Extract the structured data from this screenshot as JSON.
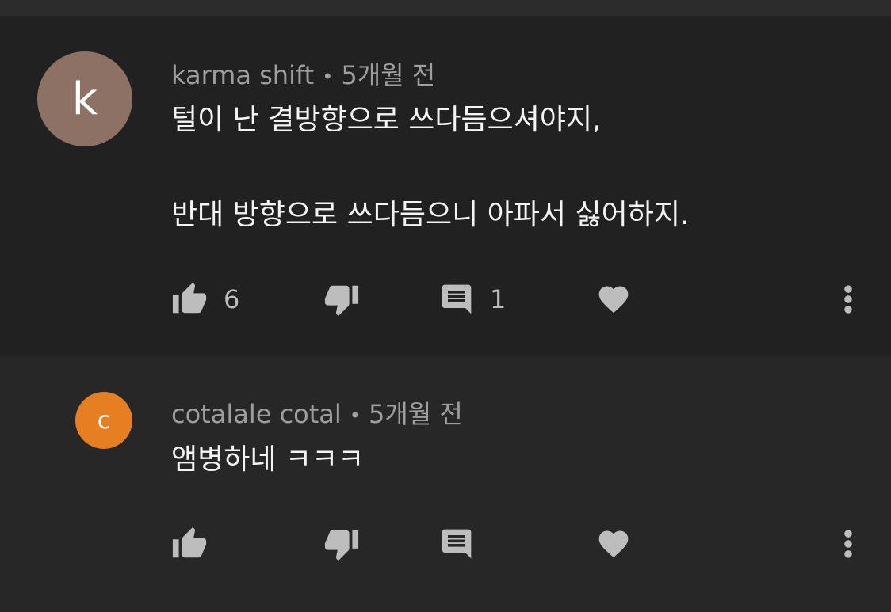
{
  "comments": [
    {
      "avatar_letter": "k",
      "avatar_color": "#8d7164",
      "author": "karma shift",
      "separator": "•",
      "time": "5개월 전",
      "text_lines": [
        "털이 난 결방향으로 쓰다듬으셔야지,",
        "",
        "반대 방향으로 쓰다듬으니 아파서 싫어하지."
      ],
      "like_count": "6",
      "reply_count": "1",
      "icons": [
        "thumbs-up-icon",
        "thumbs-down-icon",
        "comment-icon",
        "heart-icon",
        "more-vert-icon"
      ]
    },
    {
      "avatar_letter": "c",
      "avatar_color": "#e67e22",
      "author": "cotalale cotal",
      "separator": "•",
      "time": "5개월 전",
      "text_lines": [
        "앰병하네 ㅋㅋㅋ"
      ],
      "like_count": "",
      "reply_count": "",
      "icons": [
        "thumbs-up-icon",
        "thumbs-down-icon",
        "comment-icon",
        "heart-icon",
        "more-vert-icon"
      ]
    }
  ]
}
